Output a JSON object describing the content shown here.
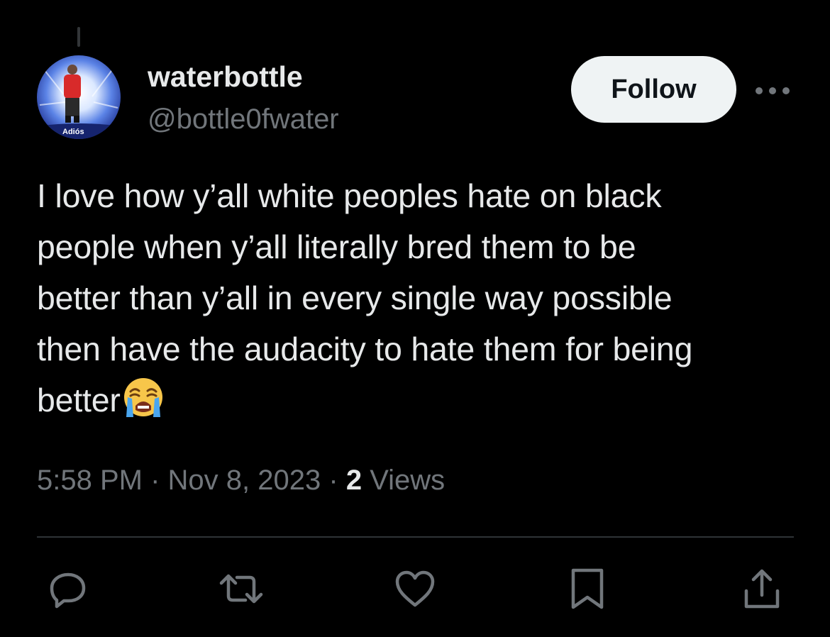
{
  "user": {
    "display_name": "waterbottle",
    "handle": "@bottle0fwater",
    "avatar_caption": "Adiós"
  },
  "follow_label": "Follow",
  "tweet": {
    "lines": [
      "I love how y’all white peoples hate on black",
      "people when y’all literally bred them to be",
      "better than y’all in every single way possible",
      "then have the audacity to hate them for being",
      "better"
    ],
    "emoji": "loudly-crying-face"
  },
  "meta": {
    "time": "5:58 PM",
    "separator": "·",
    "date": "Nov 8, 2023",
    "views_count": "2",
    "views_label": "Views"
  },
  "icons": {
    "more": "more-horizontal-icon",
    "reply": "reply-icon",
    "retweet": "retweet-icon",
    "like": "heart-icon",
    "bookmark": "bookmark-icon",
    "share": "share-icon"
  },
  "colors": {
    "background": "#000000",
    "primary_text": "#e7e9ea",
    "secondary_text": "#71767b",
    "follow_bg": "#eff3f4",
    "divider": "#2f3336"
  }
}
